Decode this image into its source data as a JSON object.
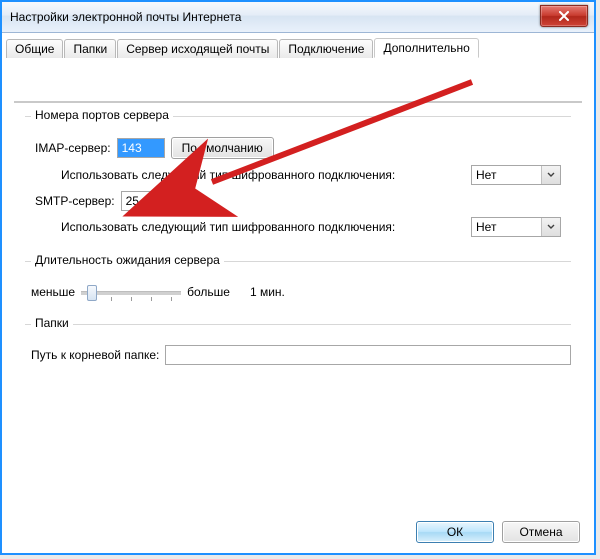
{
  "window": {
    "title": "Настройки электронной почты Интернета"
  },
  "tabs": {
    "general": "Общие",
    "folders": "Папки",
    "outgoing": "Сервер исходящей почты",
    "connection": "Подключение",
    "advanced": "Дополнительно"
  },
  "ports_group": {
    "legend": "Номера портов сервера",
    "imap_label": "IMAP-сервер:",
    "imap_value": "143",
    "defaults_btn": "По умолчанию",
    "enc_label": "Использовать следующий тип шифрованного подключения:",
    "enc_imap_value": "Нет",
    "smtp_label": "SMTP-сервер:",
    "smtp_value": "25",
    "enc_smtp_value": "Нет"
  },
  "timeout_group": {
    "legend": "Длительность ожидания сервера",
    "less": "меньше",
    "more": "больше",
    "duration": "1 мин."
  },
  "folders_group": {
    "legend": "Папки",
    "root_label": "Путь к корневой папке:",
    "root_value": ""
  },
  "footer": {
    "ok": "ОК",
    "cancel": "Отмена"
  }
}
